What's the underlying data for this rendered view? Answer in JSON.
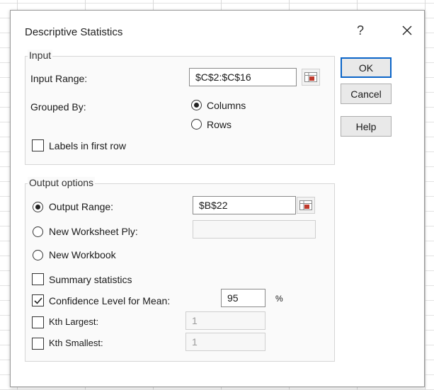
{
  "dialog": {
    "title": "Descriptive Statistics",
    "help_glyph": "?",
    "close_icon": "close-icon"
  },
  "input": {
    "group_label": "Input",
    "range_label": "Input Range:",
    "range_value": "$C$2:$C$16",
    "grouped_by_label": "Grouped By:",
    "grouped_by_options": [
      {
        "label": "Columns",
        "selected": true
      },
      {
        "label": "Rows",
        "selected": false
      }
    ],
    "labels_first_row": {
      "label": "Labels in first row",
      "checked": false
    }
  },
  "output": {
    "group_label": "Output options",
    "options": [
      {
        "label": "Output Range:",
        "selected": true
      },
      {
        "label": "New Worksheet Ply:",
        "selected": false
      },
      {
        "label": "New Workbook",
        "selected": false
      }
    ],
    "output_range_value": "$B$22",
    "new_worksheet_value": "",
    "summary_statistics": {
      "label": "Summary statistics",
      "checked": false
    },
    "confidence_level": {
      "label": "Confidence Level for Mean:",
      "checked": true,
      "value": "95",
      "unit": "%"
    },
    "kth_largest": {
      "label": "Kth Largest:",
      "checked": false,
      "value": "1"
    },
    "kth_smallest": {
      "label": "Kth Smallest:",
      "checked": false,
      "value": "1"
    }
  },
  "buttons": {
    "ok": "OK",
    "cancel": "Cancel",
    "help": "Help"
  },
  "colors": {
    "default_button_border": "#0a64c8",
    "ref_icon_red": "#c0392b"
  }
}
